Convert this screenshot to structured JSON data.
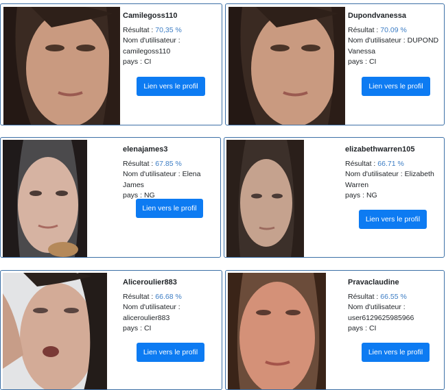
{
  "cards": [
    {
      "username": "Camilegoss110",
      "result_label": "Résultat : ",
      "result": "70,35 %",
      "user_label": "Nom d'utilisateur :",
      "user_value": "camilegoss110",
      "country_label": "pays : ",
      "country": "CI",
      "button": "Lien vers le profil",
      "photo": "portrait-photo"
    },
    {
      "username": "Dupondvanessa",
      "result_label": "Résultat : ",
      "result": "70.09 %",
      "user_label": "Nom d'utilisateur : DUPOND",
      "user_value": "Vanessa",
      "country_label": "pays : ",
      "country": "CI",
      "button": "Lien vers le profil",
      "photo": "portrait-photo"
    },
    {
      "username": "elenajames3",
      "result_label": "Résultat : ",
      "result": "67.85 %",
      "user_label": "Nom d'utilisateur : Elena James",
      "user_value": "",
      "country_label": "pays : ",
      "country": "NG",
      "button": "Lien vers le profil",
      "photo": "portrait-photo"
    },
    {
      "username": "elizabethwarren105",
      "result_label": "Résultat : ",
      "result": "66.71 %",
      "user_label": "Nom d'utilisateur : Elizabeth",
      "user_value": "Warren",
      "country_label": "pays : ",
      "country": "NG",
      "button": "Lien vers le profil",
      "photo": "portrait-photo"
    },
    {
      "username": "Aliceroulier883",
      "result_label": "Résultat : ",
      "result": "66.68 %",
      "user_label": "Nom d'utilisateur :",
      "user_value": "aliceroulier883",
      "country_label": "pays : ",
      "country": "CI",
      "button": "Lien vers le profil",
      "photo": "portrait-photo"
    },
    {
      "username": "Pravaclaudine",
      "result_label": "Résultat : ",
      "result": "66.55 %",
      "user_label": "Nom d'utilisateur :",
      "user_value": "user6129625985966",
      "country_label": "pays : ",
      "country": "CI",
      "button": "Lien vers le profil",
      "photo": "portrait-photo"
    }
  ]
}
